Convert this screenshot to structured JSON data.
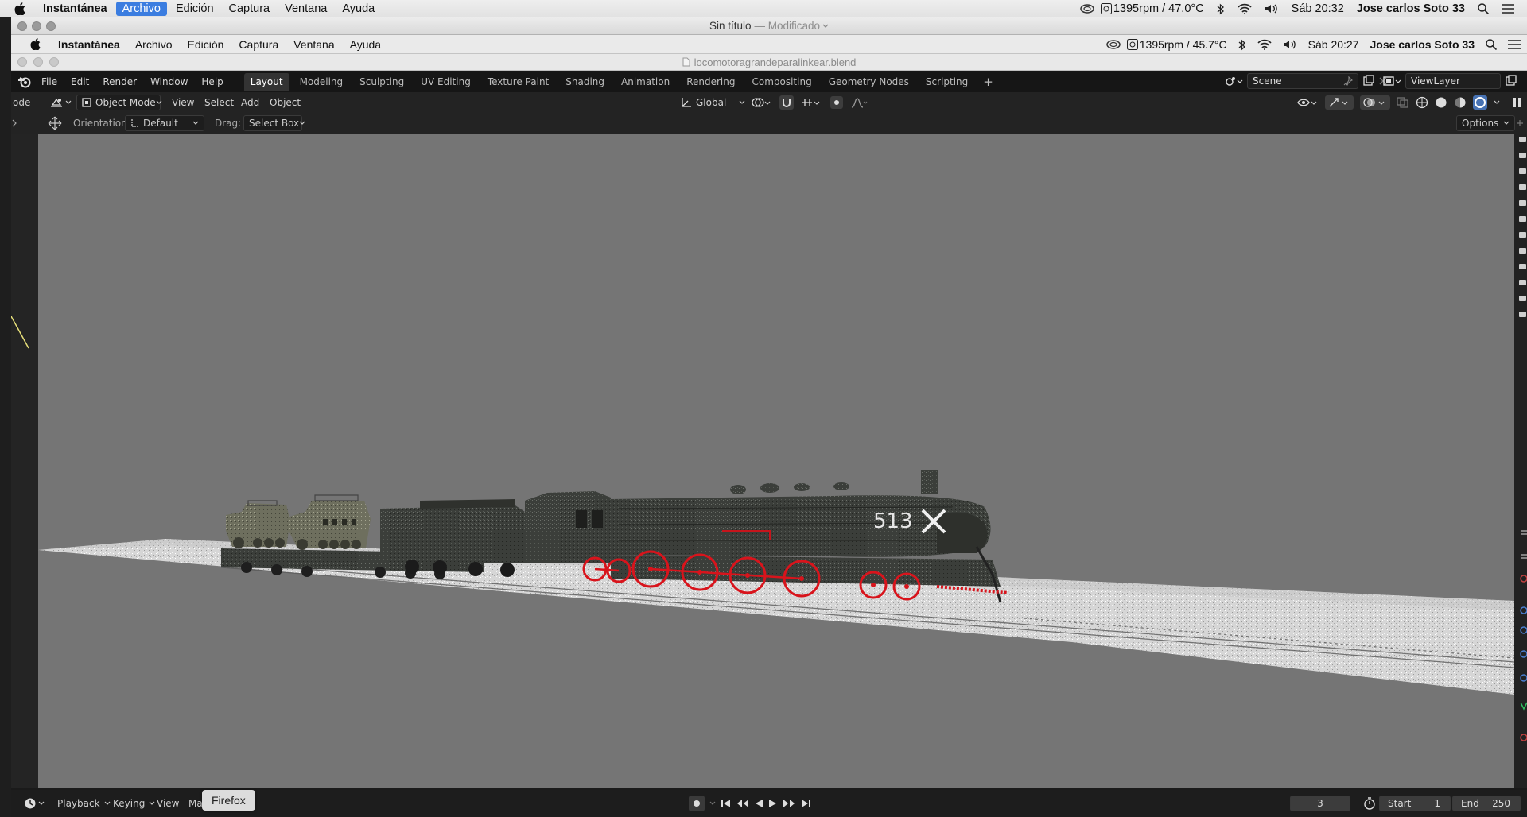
{
  "mac_menubar": {
    "items": [
      "Instantánea",
      "Archivo",
      "Edición",
      "Captura",
      "Ventana",
      "Ayuda"
    ],
    "status": {
      "fan": "1395rpm / 47.0°C",
      "clock": "Sáb 20:32",
      "user": "Jose carlos Soto 33"
    }
  },
  "window_title": {
    "title": "Sin título",
    "status": "— Modificado"
  },
  "inner_menubar": {
    "items": [
      "Instantánea",
      "Archivo",
      "Edición",
      "Captura",
      "Ventana",
      "Ayuda"
    ],
    "status": {
      "fan": "1395rpm / 45.7°C",
      "clock": "Sáb 20:27",
      "user": "Jose carlos Soto 33"
    }
  },
  "blend_file": {
    "title": "locomotoragrandeparalinkear.blend"
  },
  "blender_top": {
    "menus": [
      "File",
      "Edit",
      "Render",
      "Window",
      "Help"
    ],
    "workspaces": [
      "Layout",
      "Modeling",
      "Sculpting",
      "UV Editing",
      "Texture Paint",
      "Shading",
      "Animation",
      "Rendering",
      "Compositing",
      "Geometry Nodes",
      "Scripting"
    ],
    "active_workspace": "Layout",
    "add_tab": "+",
    "scene": "Scene",
    "view_layer": "ViewLayer"
  },
  "viewport_header": {
    "mode": "Object Mode",
    "menus": [
      "View",
      "Select",
      "Add",
      "Object"
    ],
    "transform_orientation": "Global",
    "left_cut_label": "ode"
  },
  "tool_settings": {
    "orientation_label": "Orientation:",
    "orientation_value": "Default",
    "drag_label": "Drag:",
    "drag_value": "Select Box",
    "options": "Options"
  },
  "viewport": {
    "background": "#757575",
    "locomotive_number": "513",
    "wheel_color": "#d8141c"
  },
  "timeline": {
    "menus": [
      "Playback",
      "Keying",
      "View",
      "Ma"
    ],
    "current_frame": "3",
    "start_label": "Start",
    "start_value": "1",
    "end_label": "End",
    "end_value": "250"
  },
  "tooltip": {
    "text": "Firefox"
  }
}
